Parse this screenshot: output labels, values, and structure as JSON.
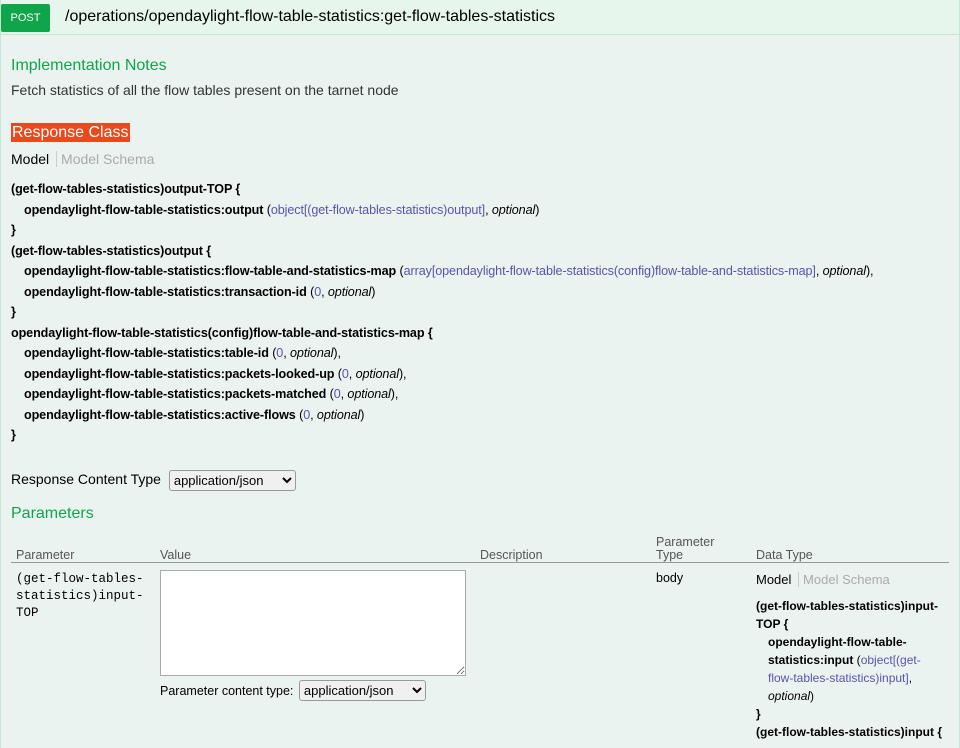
{
  "operation": {
    "method": "POST",
    "path": "/operations/opendaylight-flow-table-statistics:get-flow-tables-statistics"
  },
  "implementation_notes": {
    "title": "Implementation Notes",
    "text": "Fetch statistics of all the flow tables present on the tarnet node"
  },
  "response_class": {
    "title": "Response Class",
    "tab_model": "Model",
    "tab_schema": "Model Schema",
    "m1_head": "(get-flow-tables-statistics)output-TOP {",
    "m1_f1_name": "opendaylight-flow-table-statistics:output",
    "m1_f1_type": "object[(get-flow-tables-statistics)output]",
    "m2_head": "(get-flow-tables-statistics)output {",
    "m2_f1_name": "opendaylight-flow-table-statistics:flow-table-and-statistics-map",
    "m2_f1_type": "array[opendaylight-flow-table-statistics(config)flow-table-and-statistics-map]",
    "m2_f2_name": "opendaylight-flow-table-statistics:transaction-id",
    "m3_head": "opendaylight-flow-table-statistics(config)flow-table-and-statistics-map {",
    "m3_f1_name": "opendaylight-flow-table-statistics:table-id",
    "m3_f2_name": "opendaylight-flow-table-statistics:packets-looked-up",
    "m3_f3_name": "opendaylight-flow-table-statistics:packets-matched",
    "m3_f4_name": "opendaylight-flow-table-statistics:active-flows",
    "zero": "0",
    "optional": "optional",
    "close": "}"
  },
  "response_content_type": {
    "label": "Response Content Type",
    "value": "application/json"
  },
  "parameters": {
    "title": "Parameters",
    "headers": {
      "parameter": "Parameter",
      "value": "Value",
      "description": "Description",
      "parameter_type_1": "Parameter",
      "parameter_type_2": "Type",
      "data_type": "Data Type"
    },
    "row": {
      "name_1": "(get-flow-tables-",
      "name_2": "statistics)input-",
      "name_3": "TOP",
      "value": "",
      "content_type_label": "Parameter content type:",
      "content_type_value": "application/json",
      "type": "body",
      "dt_tab_model": "Model",
      "dt_tab_schema": "Model Schema",
      "dt_head_1": "(get-flow-tables-statistics)input-",
      "dt_head_2": "TOP {",
      "dt_f1_1": "opendaylight-flow-table-",
      "dt_f1_2": "statistics:input",
      "dt_f1_type_1": "object[(get-",
      "dt_f1_type_2": "flow-tables-statistics)input]",
      "dt_optional": "optional",
      "dt_close": "}",
      "dt_next": "(get-flow-tables-statistics)input {"
    }
  },
  "colors": {
    "accent": "#10a54a",
    "response_class_bg": "#e84a1e",
    "panel_bg": "#ebf3f0",
    "ref": "#5555aa"
  }
}
